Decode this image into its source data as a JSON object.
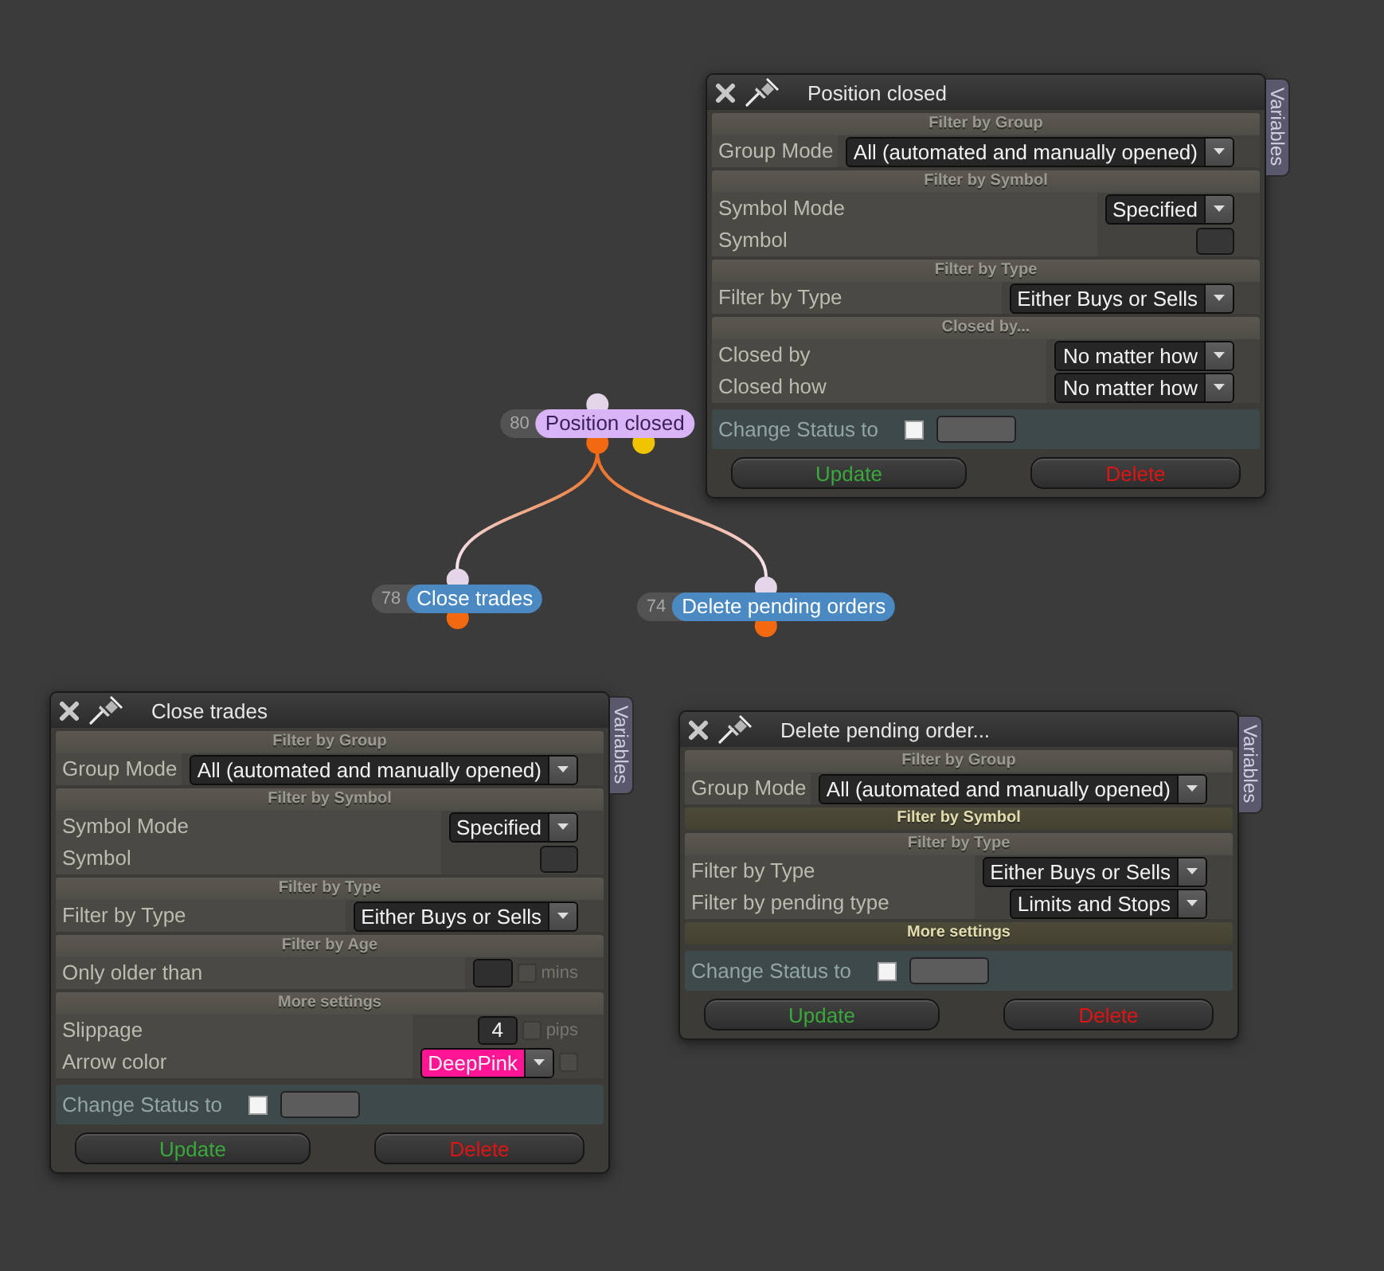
{
  "canvas": {
    "nodes": [
      {
        "number": "80",
        "title": "Position closed",
        "color": "#d9b4f6",
        "ports": [
          {
            "kind": "input",
            "color": "#e4d6e8"
          },
          {
            "kind": "output",
            "color": "#f2690f"
          },
          {
            "kind": "output",
            "color": "#f0c400"
          }
        ],
        "children": [
          {
            "number": "78",
            "title": "Close trades",
            "color": "#4a89c2",
            "ports": [
              {
                "kind": "input",
                "color": "#e4d6e8"
              },
              {
                "kind": "output",
                "color": "#f2690f"
              }
            ]
          },
          {
            "number": "74",
            "title": "Delete pending orders",
            "color": "#4a89c2",
            "ports": [
              {
                "kind": "input",
                "color": "#e4d6e8"
              },
              {
                "kind": "output",
                "color": "#f2690f"
              }
            ]
          }
        ]
      }
    ]
  },
  "windows": [
    {
      "title": "Position closed",
      "side_tab": "Variables",
      "sections": [
        {
          "heading": "Filter by Group",
          "expanded": true,
          "rows": [
            {
              "label": "Group Mode",
              "kind": "dropdown",
              "value": "All (automated and manually opened)"
            }
          ]
        },
        {
          "heading": "Filter by Symbol",
          "expanded": true,
          "rows": [
            {
              "label": "Symbol Mode",
              "kind": "dropdown",
              "value": "Specified"
            },
            {
              "label": "Symbol",
              "kind": "text"
            }
          ]
        },
        {
          "heading": "Filter by Type",
          "expanded": true,
          "rows": [
            {
              "label": "Filter by Type",
              "kind": "dropdown",
              "value": "Either Buys or Sells"
            }
          ]
        },
        {
          "heading": "Closed by...",
          "expanded": true,
          "rows": [
            {
              "label": "Closed by",
              "kind": "dropdown",
              "value": "No matter how"
            },
            {
              "label": "Closed how",
              "kind": "dropdown",
              "value": "No matter how"
            }
          ]
        }
      ],
      "status": {
        "label": "Change Status to",
        "checked": false
      },
      "buttons": [
        {
          "label": "Update",
          "kind": "update"
        },
        {
          "label": "Delete",
          "kind": "delete"
        }
      ]
    },
    {
      "title": "Close trades",
      "side_tab": "Variables",
      "sections": [
        {
          "heading": "Filter by Group",
          "expanded": true,
          "rows": [
            {
              "label": "Group Mode",
              "kind": "dropdown",
              "value": "All (automated and manually opened)"
            }
          ]
        },
        {
          "heading": "Filter by Symbol",
          "expanded": true,
          "rows": [
            {
              "label": "Symbol Mode",
              "kind": "dropdown",
              "value": "Specified"
            },
            {
              "label": "Symbol",
              "kind": "text"
            }
          ]
        },
        {
          "heading": "Filter by Type",
          "expanded": true,
          "rows": [
            {
              "label": "Filter by Type",
              "kind": "dropdown",
              "value": "Either Buys or Sells"
            }
          ]
        },
        {
          "heading": "Filter by Age",
          "expanded": true,
          "rows": [
            {
              "label": "Only older than",
              "kind": "amount",
              "unit": "mins",
              "checked": false
            }
          ]
        },
        {
          "heading": "More settings",
          "expanded": true,
          "rows": [
            {
              "label": "Slippage",
              "kind": "amount",
              "value": "4",
              "unit": "pips",
              "checked": false
            },
            {
              "label": "Arrow color",
              "kind": "color",
              "value": "DeepPink",
              "color": "#ff1493",
              "checked": false
            }
          ]
        }
      ],
      "status": {
        "label": "Change Status to",
        "checked": false
      },
      "buttons": [
        {
          "label": "Update",
          "kind": "update"
        },
        {
          "label": "Delete",
          "kind": "delete"
        }
      ]
    },
    {
      "title": "Delete pending order...",
      "side_tab": "Variables",
      "sections": [
        {
          "heading": "Filter by Group",
          "expanded": true,
          "rows": [
            {
              "label": "Group Mode",
              "kind": "dropdown",
              "value": "All (automated and manually opened)"
            }
          ]
        },
        {
          "heading": "Filter by Symbol",
          "expanded": false
        },
        {
          "heading": "Filter by Type",
          "expanded": true,
          "rows": [
            {
              "label": "Filter by Type",
              "kind": "dropdown",
              "value": "Either Buys or Sells"
            },
            {
              "label": "Filter by pending type",
              "kind": "dropdown",
              "value": "Limits and Stops"
            }
          ]
        },
        {
          "heading": "More settings",
          "expanded": false
        }
      ],
      "status": {
        "label": "Change Status to",
        "checked": false
      },
      "buttons": [
        {
          "label": "Update",
          "kind": "update"
        },
        {
          "label": "Delete",
          "kind": "delete"
        }
      ]
    }
  ]
}
